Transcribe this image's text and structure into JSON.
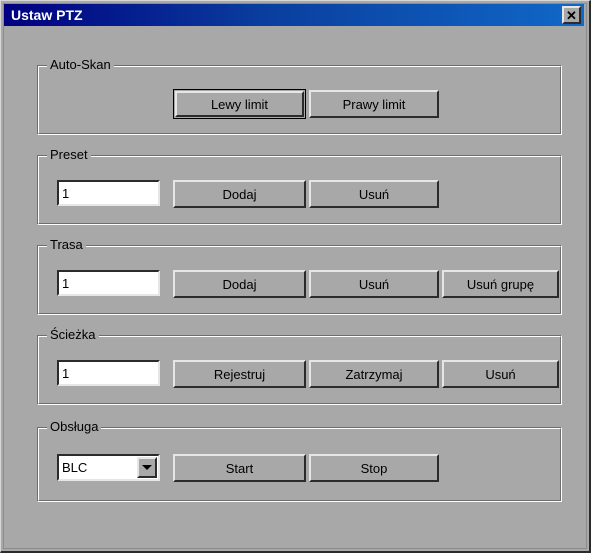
{
  "window": {
    "title": "Ustaw PTZ",
    "close_label": "✕",
    "close_icon": "close-icon"
  },
  "groups": [
    {
      "key": "autoskan",
      "label": "Auto-Skan",
      "buttons": [
        {
          "label": "Lewy limit",
          "default": true
        },
        {
          "label": "Prawy limit",
          "default": false
        }
      ]
    },
    {
      "key": "preset",
      "label": "Preset",
      "input": {
        "value": "1",
        "placeholder": ""
      },
      "buttons": [
        {
          "label": "Dodaj",
          "default": false
        },
        {
          "label": "Usuń",
          "default": false
        }
      ]
    },
    {
      "key": "trasa",
      "label": "Trasa",
      "input": {
        "value": "1",
        "placeholder": ""
      },
      "buttons": [
        {
          "label": "Dodaj",
          "default": false
        },
        {
          "label": "Usuń",
          "default": false
        },
        {
          "label": "Usuń grupę",
          "default": false
        }
      ]
    },
    {
      "key": "sciezka",
      "label": "Ścieżka",
      "input": {
        "value": "1",
        "placeholder": ""
      },
      "buttons": [
        {
          "label": "Rejestruj",
          "default": false
        },
        {
          "label": "Zatrzymaj",
          "default": false
        },
        {
          "label": "Usuń",
          "default": false
        }
      ]
    },
    {
      "key": "obsluga",
      "label": "Obsługa",
      "combo": {
        "value": "BLC",
        "arrow_icon": "chevron-down-icon"
      },
      "buttons": [
        {
          "label": "Start",
          "default": false
        },
        {
          "label": "Stop",
          "default": false
        }
      ]
    }
  ],
  "colors": {
    "face": "#a8a8a8",
    "title_gradient_start": "#000080",
    "title_gradient_end": "#1068c8",
    "text": "#000000",
    "field_background": "#ffffff"
  }
}
